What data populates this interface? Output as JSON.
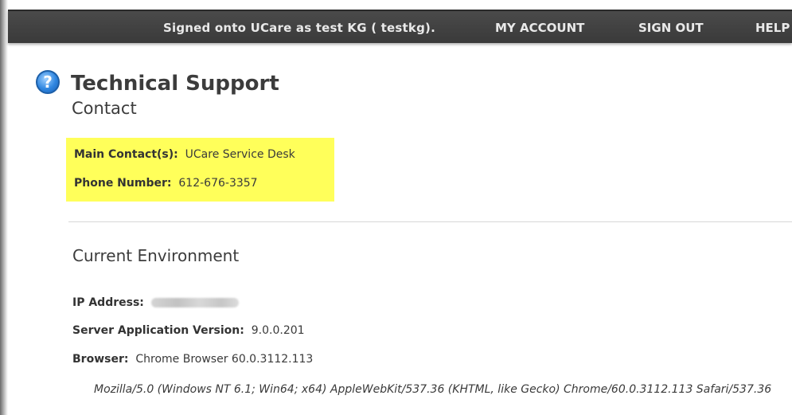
{
  "header": {
    "signed_in_prefix": "Signed onto ",
    "app_name": "UCare",
    "signed_in_mid": " as ",
    "user_name": "test KG",
    "user_login": " ( testkg).",
    "nav": [
      {
        "label": "MY ACCOUNT"
      },
      {
        "label": "SIGN OUT"
      },
      {
        "label": "HELP"
      }
    ]
  },
  "page": {
    "title": "Technical Support",
    "subtitle": "Contact"
  },
  "contact": {
    "main_contact_label": "Main Contact(s):",
    "main_contact_value": "UCare Service Desk",
    "phone_label": "Phone Number:",
    "phone_value": "612-676-3357",
    "highlight_color": "#ffff5a"
  },
  "environment": {
    "heading": "Current Environment",
    "ip_label": "IP Address:",
    "server_label": "Server Application Version:",
    "server_value": "9.0.0.201",
    "browser_label": "Browser:",
    "browser_value": "Chrome Browser 60.0.3112.113",
    "user_agent": "Mozilla/5.0 (Windows NT 6.1; Win64; x64) AppleWebKit/537.36 (KHTML, like Gecko) Chrome/60.0.3112.113 Safari/537.36"
  },
  "colors": {
    "topbar": "#3f3f3f",
    "topbar_text": "#e9e9e9",
    "help_icon": "#2f86e0"
  },
  "icons": {
    "help": "question-circle-icon"
  }
}
